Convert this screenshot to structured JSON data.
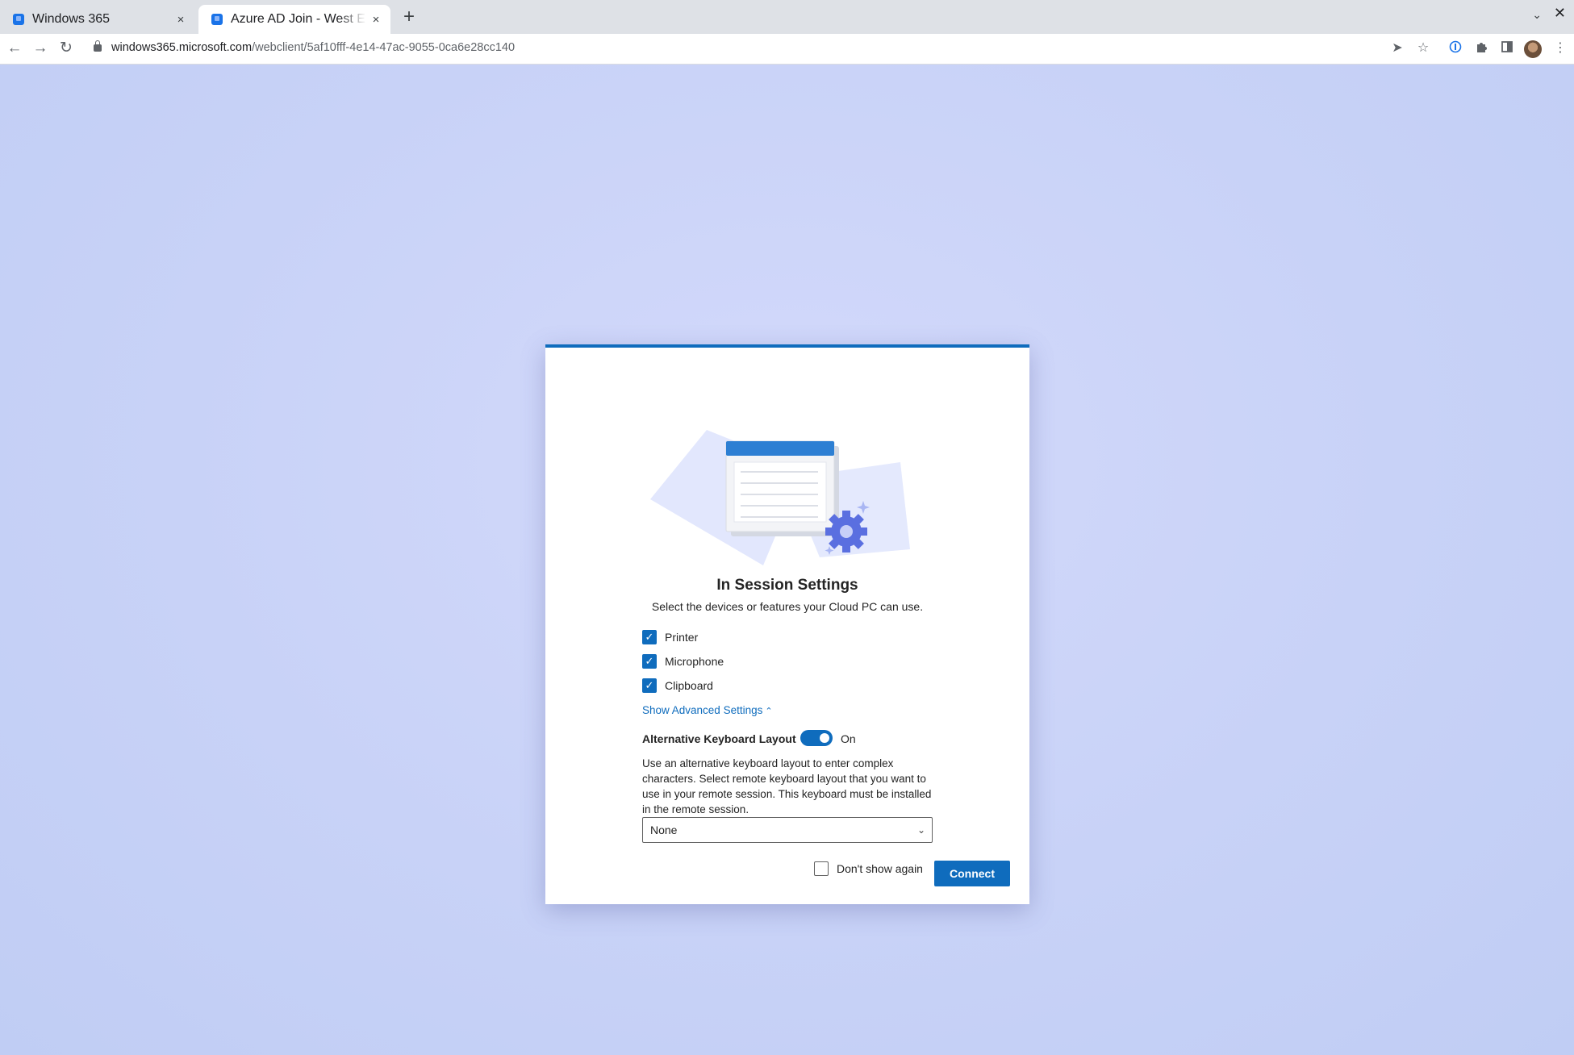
{
  "browser": {
    "tabs": [
      {
        "title": "Windows 365",
        "active": false
      },
      {
        "title": "Azure AD Join - West Euro",
        "active": true
      }
    ],
    "new_tab_label": "+",
    "close_glyph": "×",
    "url_host": "windows365.microsoft.com",
    "url_path": "/webclient/5af10fff-4e14-47ac-9055-0ca6e28cc140",
    "icons": {
      "back": "arrow-left-icon",
      "forward": "arrow-right-icon",
      "reload": "reload-icon",
      "lock": "lock-icon",
      "share": "share-icon",
      "bookmark": "star-icon",
      "password_manager": "password-manager-icon",
      "extensions": "puzzle-icon",
      "side_panel": "side-panel-icon",
      "profile": "avatar",
      "menu": "kebab-menu-icon"
    }
  },
  "dialog": {
    "title": "In Session Settings",
    "subtitle": "Select the devices or features your Cloud PC can use.",
    "devices": [
      {
        "label": "Printer",
        "checked": true
      },
      {
        "label": "Microphone",
        "checked": true
      },
      {
        "label": "Clipboard",
        "checked": true
      }
    ],
    "advanced_link": "Show Advanced Settings",
    "alt_keyboard": {
      "label": "Alternative Keyboard Layout",
      "state": "On",
      "enabled": true,
      "description": "Use an alternative keyboard layout to enter complex characters. Select remote keyboard layout that you want to use in your remote session. This keyboard must be installed in the remote session.",
      "selected_layout": "None"
    },
    "dont_show_again": {
      "label": "Don't show again",
      "checked": false
    },
    "connect_button": "Connect"
  },
  "colors": {
    "accent": "#0f6cbd",
    "page_background": "#c9d3f6"
  }
}
